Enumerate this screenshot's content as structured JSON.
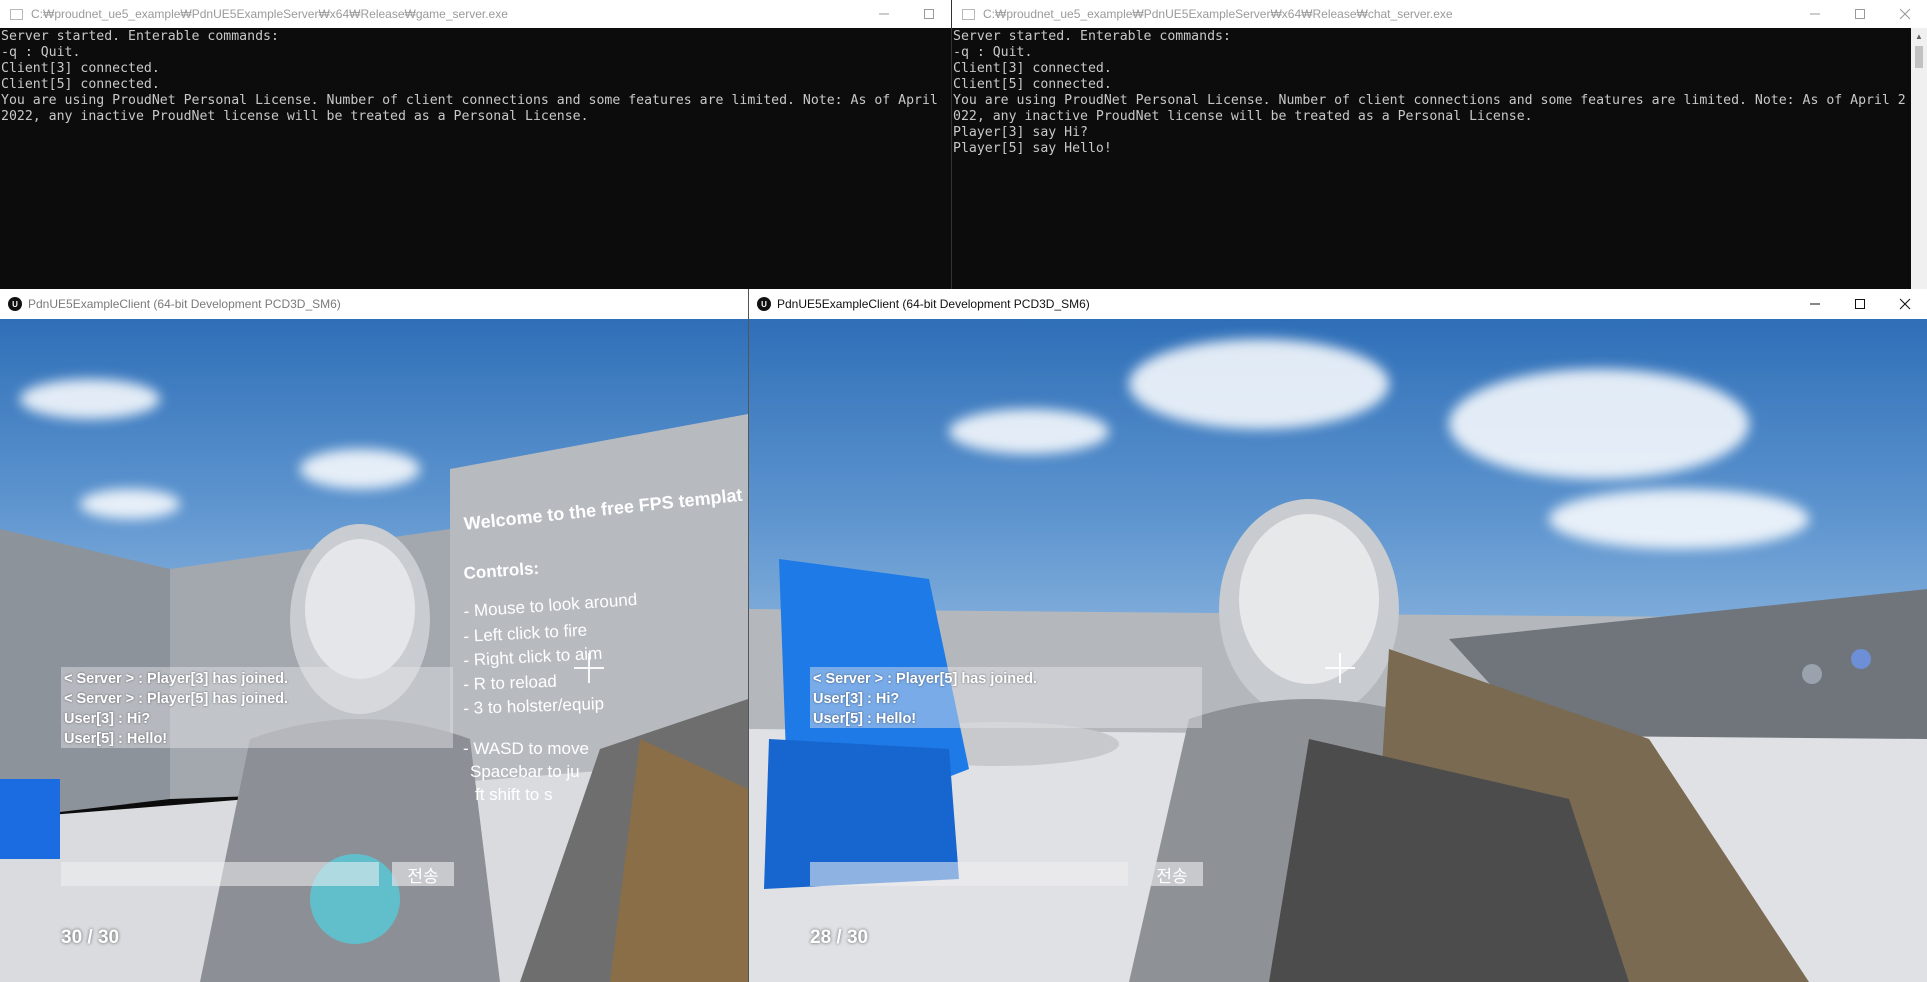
{
  "game_server": {
    "title": "C:₩proudnet_ue5_example₩PdnUE5ExampleServer₩x64₩Release₩game_server.exe",
    "output": "Server started. Enterable commands:\n-q : Quit.\nClient[3] connected.\nClient[5] connected.\nYou are using ProudNet Personal License. Number of client connections and some features are limited. Note: As of April 2022, any inactive ProudNet license will be treated as a Personal License."
  },
  "chat_server": {
    "title": "C:₩proudnet_ue5_example₩PdnUE5ExampleServer₩x64₩Release₩chat_server.exe",
    "output": "Server started. Enterable commands:\n-q : Quit.\nClient[3] connected.\nClient[5] connected.\nYou are using ProudNet Personal License. Number of client connections and some features are limited. Note: As of April 2022, any inactive ProudNet license will be treated as a Personal License.\nPlayer[3] say Hi?\nPlayer[5] say Hello!"
  },
  "client_left": {
    "title": "PdnUE5ExampleClient (64-bit Development PCD3D_SM6)",
    "wall_text": {
      "welcome": "Welcome to the free FPS templat",
      "controls": "Controls:",
      "lines": [
        "- Mouse to look around",
        "- Left click to fire",
        "- Right click to aim",
        "- R to reload",
        "- 3 to holster/equip",
        "- WASD to move",
        "Spacebar to ju",
        "ft shift to s"
      ]
    },
    "chat_lines": [
      "< Server > : Player[3] has joined.",
      "< Server > : Player[5] has joined.",
      "User[3] : Hi?",
      "User[5] : Hello!"
    ],
    "send_label": "전송",
    "ammo": "30 / 30"
  },
  "client_right": {
    "title": "PdnUE5ExampleClient (64-bit Development PCD3D_SM6)",
    "chat_lines": [
      "< Server > : Player[5] has joined.",
      "User[3] : Hi?",
      "User[5] : Hello!"
    ],
    "send_label": "전송",
    "ammo": "28 / 30"
  }
}
